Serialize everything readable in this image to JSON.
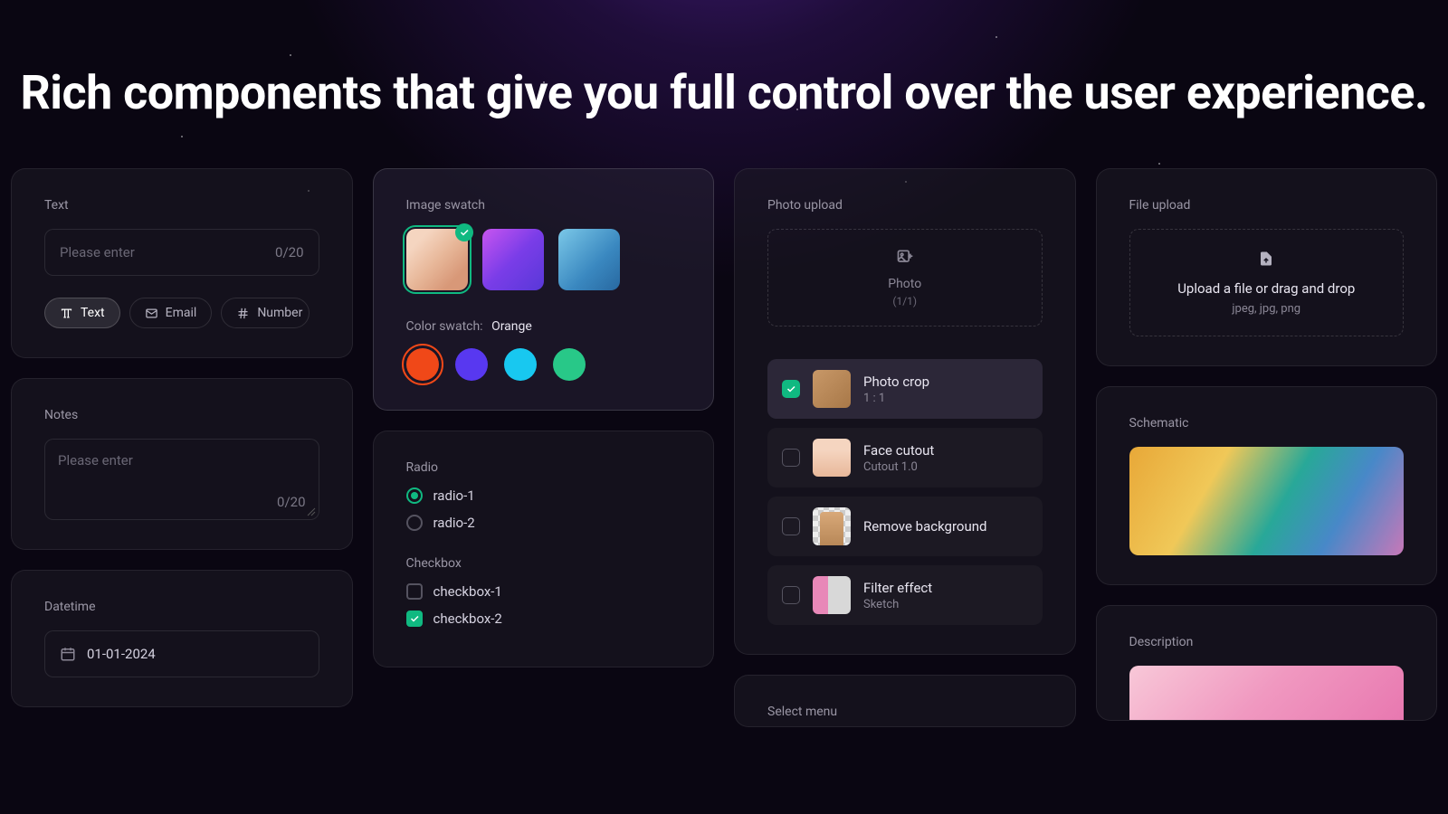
{
  "heading": "Rich components that give you full control over the user experience.",
  "text_card": {
    "label": "Text",
    "placeholder": "Please enter",
    "counter": "0/20",
    "chips": [
      "Text",
      "Email",
      "Number"
    ]
  },
  "notes_card": {
    "label": "Notes",
    "placeholder": "Please enter",
    "counter": "0/20"
  },
  "datetime_card": {
    "label": "Datetime",
    "value": "01-01-2024"
  },
  "image_swatch": {
    "label": "Image swatch",
    "color_label": "Color swatch:",
    "color_value": "Orange",
    "colors": [
      "#f04818",
      "#5838f0",
      "#18c8f0",
      "#28c888"
    ]
  },
  "radio_card": {
    "radio_label": "Radio",
    "radios": [
      "radio-1",
      "radio-2"
    ],
    "checkbox_label": "Checkbox",
    "checkboxes": [
      "checkbox-1",
      "checkbox-2"
    ]
  },
  "photo_upload": {
    "label": "Photo upload",
    "zone_title": "Photo",
    "zone_sub": "(1/1)",
    "options": [
      {
        "name": "Photo crop",
        "sub": "1 : 1"
      },
      {
        "name": "Face cutout",
        "sub": "Cutout 1.0"
      },
      {
        "name": "Remove background",
        "sub": ""
      },
      {
        "name": "Filter effect",
        "sub": "Sketch"
      }
    ]
  },
  "select_card": {
    "label": "Select menu"
  },
  "file_upload": {
    "label": "File upload",
    "title": "Upload a file or drag and drop",
    "sub": "jpeg, jpg, png"
  },
  "schematic": {
    "label": "Schematic"
  },
  "description": {
    "label": "Description"
  }
}
